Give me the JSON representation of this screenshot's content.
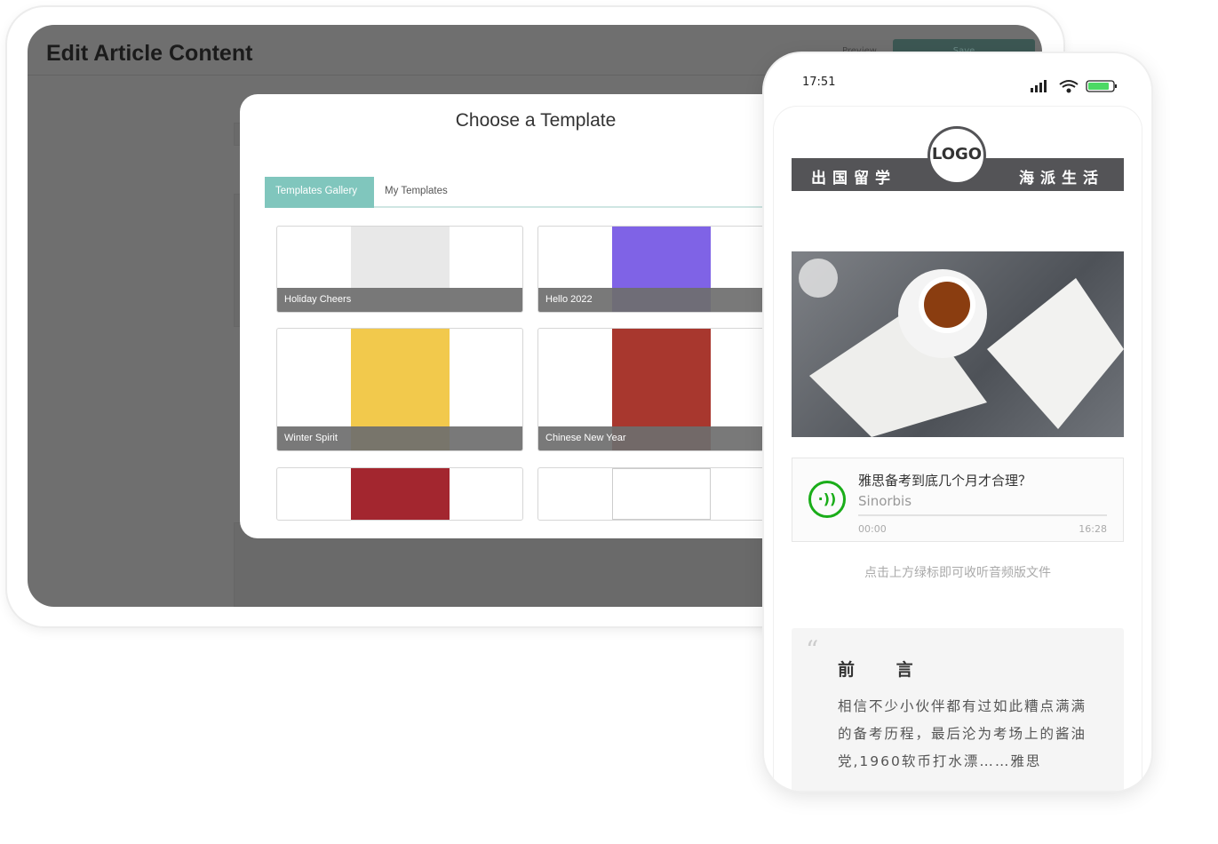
{
  "editor": {
    "title": "Edit Article Content",
    "preview_label": "Preview",
    "save_label": "Save"
  },
  "modal": {
    "title": "Choose a Template",
    "tabs": [
      {
        "label": "Templates Gallery",
        "active": true
      },
      {
        "label": "My Templates",
        "active": false
      }
    ],
    "templates": [
      {
        "name": "Holiday Cheers",
        "color": "#e8e8e8"
      },
      {
        "name": "Hello 2022",
        "color": "#7f63e6"
      },
      {
        "name": "Winter Spirit",
        "color": "#f2c94c"
      },
      {
        "name": "Chinese New Year",
        "color": "#a8372e"
      },
      {
        "name": "",
        "color": "#a3262f"
      },
      {
        "name": "",
        "color": "#ffffff"
      }
    ]
  },
  "phone": {
    "time": "17:51",
    "banner_left": "出国留学",
    "banner_right": "海派生活",
    "logo": "LOGO",
    "audio": {
      "title": "雅思备考到底几个月才合理？",
      "author": "Sinorbis",
      "current": "00:00",
      "duration": "16:28",
      "progress": 0,
      "accent": "#1aad19"
    },
    "hint": "点击上方绿标即可收听音频版文件",
    "quote": {
      "heading": "前 言",
      "body": "相信不少小伙伴都有过如此糟点满满的备考历程，最后沦为考场上的酱油党,1960软币打水漂……雅思"
    }
  }
}
